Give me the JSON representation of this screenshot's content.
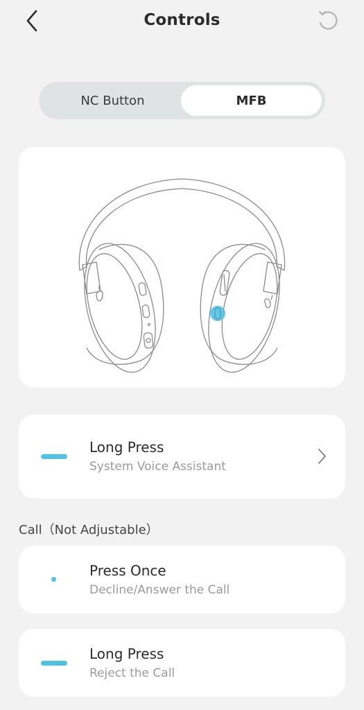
{
  "header": {
    "title": "Controls",
    "back_icon": "chevron-left-icon",
    "reset_icon": "reset-icon"
  },
  "tabs": [
    {
      "label": "NC Button",
      "selected": false
    },
    {
      "label": "MFB",
      "selected": true
    }
  ],
  "illustration": {
    "subject": "headphones",
    "highlight_color": "#4fc2e6"
  },
  "custom_control": {
    "gesture_icon": "long-press-dash-icon",
    "title": "Long Press",
    "subtitle": "System Voice Assistant",
    "chevron_icon": "chevron-right-icon"
  },
  "call_section": {
    "label": "Call（Not Adjustable）",
    "items": [
      {
        "gesture_icon": "single-press-dot-icon",
        "title": "Press Once",
        "subtitle": "Decline/Answer the Call"
      },
      {
        "gesture_icon": "long-press-dash-icon",
        "title": "Long Press",
        "subtitle": "Reject the Call"
      }
    ]
  },
  "colors": {
    "accent": "#4fc2e6",
    "background": "#f2f2f2",
    "card": "#ffffff",
    "segment_track": "#e0e3e4"
  }
}
